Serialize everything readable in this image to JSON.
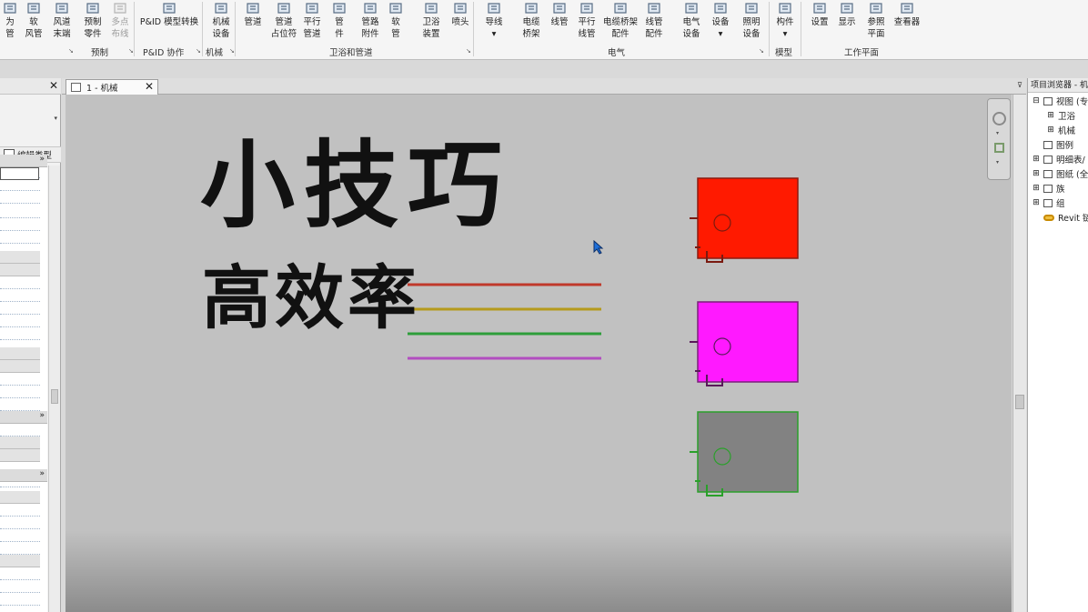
{
  "ribbon": {
    "tools": [
      {
        "id": "tool-partial",
        "label1": "为",
        "label2": "管",
        "icon": "duct-icon",
        "disabled": false
      },
      {
        "id": "tool-flex-duct",
        "label1": "软",
        "label2": "风管",
        "icon": "flex-duct-icon",
        "disabled": false
      },
      {
        "id": "tool-air-terminal",
        "label1": "风道",
        "label2": "末端",
        "icon": "air-terminal-icon",
        "disabled": false
      },
      {
        "id": "tool-fabrication-part",
        "label1": "预制",
        "label2": "零件",
        "icon": "fabrication-part-icon",
        "disabled": false
      },
      {
        "id": "tool-multipoint-routing",
        "label1": "多点",
        "label2": "布线",
        "icon": "multipoint-routing-icon",
        "disabled": true
      },
      {
        "id": "tool-pid-model-convert",
        "label1": "P&ID 模型转换",
        "label2": "",
        "icon": "pid-convert-icon",
        "disabled": false
      },
      {
        "id": "tool-mechanical-equipment",
        "label1": "机械",
        "label2": "设备",
        "icon": "fan-icon",
        "disabled": false
      },
      {
        "id": "tool-pipe",
        "label1": "管道",
        "label2": "",
        "icon": "pipe-icon",
        "disabled": false
      },
      {
        "id": "tool-pipe-placeholder",
        "label1": "管道",
        "label2": "占位符",
        "icon": "pipe-placeholder-icon",
        "disabled": false
      },
      {
        "id": "tool-parallel-pipes",
        "label1": "平行",
        "label2": "管道",
        "icon": "parallel-pipes-icon",
        "disabled": false
      },
      {
        "id": "tool-pipe-fitting",
        "label1": "管",
        "label2": "件",
        "icon": "pipe-fitting-icon",
        "disabled": false
      },
      {
        "id": "tool-pipe-accessory",
        "label1": "管路",
        "label2": "附件",
        "icon": "pipe-accessory-icon",
        "disabled": false
      },
      {
        "id": "tool-flex-pipe",
        "label1": "软",
        "label2": "管",
        "icon": "flex-pipe-icon",
        "disabled": false
      },
      {
        "id": "tool-plumbing-fixture",
        "label1": "卫浴",
        "label2": "装置",
        "icon": "plumbing-fixture-icon",
        "disabled": false
      },
      {
        "id": "tool-sprinkler",
        "label1": "喷头",
        "label2": "",
        "icon": "sprinkler-icon",
        "disabled": false
      },
      {
        "id": "tool-wire",
        "label1": "导线",
        "label2": "▾",
        "icon": "wire-icon",
        "disabled": false
      },
      {
        "id": "tool-cable-tray",
        "label1": "电缆",
        "label2": "桥架",
        "icon": "cable-tray-icon",
        "disabled": false
      },
      {
        "id": "tool-conduit",
        "label1": "线管",
        "label2": "",
        "icon": "conduit-icon",
        "disabled": false
      },
      {
        "id": "tool-parallel-conduits",
        "label1": "平行",
        "label2": "线管",
        "icon": "parallel-conduits-icon",
        "disabled": false
      },
      {
        "id": "tool-cable-tray-fitting",
        "label1": "电缆桥架",
        "label2": "配件",
        "icon": "cable-tray-fitting-icon",
        "disabled": false
      },
      {
        "id": "tool-conduit-fitting",
        "label1": "线管",
        "label2": "配件",
        "icon": "conduit-fitting-icon",
        "disabled": false
      },
      {
        "id": "tool-electrical-equipment",
        "label1": "电气",
        "label2": "设备",
        "icon": "electrical-equipment-icon",
        "disabled": false
      },
      {
        "id": "tool-device",
        "label1": "设备",
        "label2": "▾",
        "icon": "device-icon",
        "disabled": false
      },
      {
        "id": "tool-lighting-fixture",
        "label1": "照明",
        "label2": "设备",
        "icon": "lighting-fixture-icon",
        "disabled": false
      },
      {
        "id": "tool-component",
        "label1": "构件",
        "label2": "▾",
        "icon": "component-icon",
        "disabled": false
      },
      {
        "id": "tool-set",
        "label1": "设置",
        "label2": "",
        "icon": "workplane-set-icon",
        "disabled": false
      },
      {
        "id": "tool-show",
        "label1": "显示",
        "label2": "",
        "icon": "workplane-show-icon",
        "disabled": false
      },
      {
        "id": "tool-ref-plane",
        "label1": "参照",
        "label2": "平面",
        "icon": "ref-plane-icon",
        "disabled": false
      },
      {
        "id": "tool-viewer",
        "label1": "查看器",
        "label2": "",
        "icon": "viewer-icon",
        "disabled": false
      }
    ],
    "panels": [
      {
        "id": "panel-prefab",
        "label": "预制",
        "launcher": "↘"
      },
      {
        "id": "panel-pid",
        "label": "P&ID 协作",
        "launcher": "↘"
      },
      {
        "id": "panel-mechanical",
        "label": "机械",
        "launcher": "↘"
      },
      {
        "id": "panel-plumbing-piping",
        "label": "卫浴和管道",
        "launcher": "↘"
      },
      {
        "id": "panel-electrical",
        "label": "电气",
        "launcher": "↘"
      },
      {
        "id": "panel-model",
        "label": "模型",
        "launcher": ""
      },
      {
        "id": "panel-workplane",
        "label": "工作平面",
        "launcher": ""
      }
    ],
    "left_launcher": "↘"
  },
  "properties": {
    "close": "✕",
    "type_dropdown": "▾",
    "edit_type_label": "编辑类型",
    "section_collapse": "»"
  },
  "view_tab": {
    "label": "1 - 机械",
    "close": "✕",
    "overflow": "⊽"
  },
  "canvas": {
    "title_main": "小技巧",
    "title_sub": "高效率",
    "lines": [
      {
        "name": "red-pipe-line",
        "color": "#c0392b"
      },
      {
        "name": "yellow-pipe-line",
        "color": "#b59a1c"
      },
      {
        "name": "green-pipe-line",
        "color": "#2e9e3a"
      },
      {
        "name": "purple-pipe-line",
        "color": "#b24ec0"
      }
    ],
    "boxes": [
      {
        "name": "red-equipment-box",
        "fill": "#ff1a00",
        "stroke": "#8a1a10",
        "connector": "#7a1a10"
      },
      {
        "name": "magenta-equipment-box",
        "fill": "#ff19ff",
        "stroke": "#7a207a",
        "connector": "#5a1a5a"
      },
      {
        "name": "gray-equipment-box",
        "fill": "#828282",
        "stroke": "#2aa02a",
        "connector": "#2aa02a"
      }
    ]
  },
  "browser": {
    "title": "项目浏览器 - 机",
    "items": [
      {
        "name": "browser-views",
        "label": "视图 (专",
        "level": 0,
        "toggle": "⊟",
        "icon": "views-icon"
      },
      {
        "name": "browser-plumbing",
        "label": "卫浴",
        "level": 1,
        "toggle": "⊞",
        "icon": ""
      },
      {
        "name": "browser-mechanical",
        "label": "机械",
        "level": 1,
        "toggle": "⊞",
        "icon": ""
      },
      {
        "name": "browser-legends",
        "label": "图例",
        "level": 0,
        "toggle": "",
        "icon": "legend-icon"
      },
      {
        "name": "browser-schedules",
        "label": "明细表/",
        "level": 0,
        "toggle": "⊞",
        "icon": "schedule-icon"
      },
      {
        "name": "browser-sheets",
        "label": "图纸 (全",
        "level": 0,
        "toggle": "⊞",
        "icon": "sheet-icon"
      },
      {
        "name": "browser-families",
        "label": "族",
        "level": 0,
        "toggle": "⊞",
        "icon": "family-icon"
      },
      {
        "name": "browser-groups",
        "label": "组",
        "level": 0,
        "toggle": "⊞",
        "icon": "group-icon"
      },
      {
        "name": "browser-revit-links",
        "label": "Revit 链",
        "level": 0,
        "toggle": "",
        "icon": "revit-link-icon"
      }
    ]
  }
}
